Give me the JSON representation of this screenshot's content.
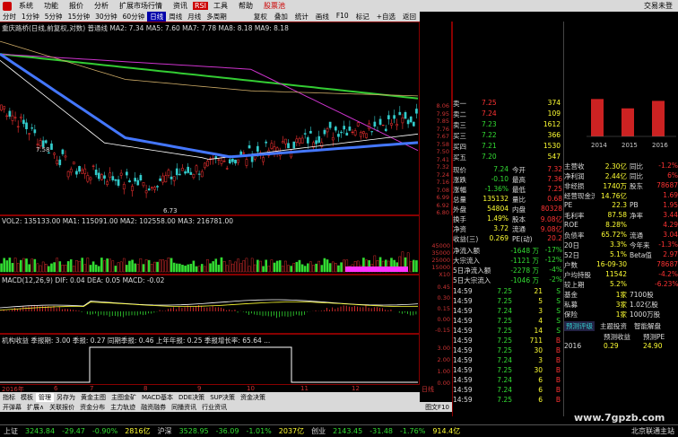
{
  "app": {
    "title_right": "交易未登",
    "menu": [
      "系统",
      "功能",
      "报价",
      "分析",
      "扩展市场行情",
      "资讯",
      "工具",
      "帮助"
    ],
    "badge": "RSI",
    "badge2": "股票池"
  },
  "periods": [
    "分时",
    "1分钟",
    "5分钟",
    "15分钟",
    "30分钟",
    "60分钟",
    "日线",
    "周线",
    "月线",
    "多周期"
  ],
  "period_active": 6,
  "toolbar": [
    "复权",
    "叠加",
    "统计",
    "画线",
    "F10",
    "标记",
    "+自选",
    "返回"
  ],
  "kline": {
    "header": "重庆路桥(日线,前复权,对数) 普通线 MA2: 7.34 MA5: 7.60 MA7: 7.78 MA8: 8.18 MA9: 8.18",
    "high_label": "7.58",
    "low_label": "6.73",
    "axis": [
      "8.06",
      "7.95",
      "7.85",
      "7.76",
      "7.67",
      "7.58",
      "7.50",
      "7.41",
      "7.32",
      "7.24",
      "7.16",
      "7.08",
      "6.99",
      "6.92",
      "6.80"
    ]
  },
  "volume": {
    "header": "VOL2: 135133.00 MA1: 115091.00 MA2: 102558.00 MA3: 216781.00",
    "axis": [
      "45000",
      "35000",
      "25000",
      "15000",
      "X10"
    ]
  },
  "macd": {
    "header": "MACD(12,26,9) DIF: 0.04 DEA: 0.05 MACD: -0.02",
    "axis": [
      "0.45",
      "0.30",
      "0.15",
      "0.00",
      "-0.15"
    ]
  },
  "ind": {
    "header": "机构收益 季报期: 3.00 季报: 0.27 同期季报: 0.46 上年年报: 0.25 季报增长率: 65.64 ...",
    "axis": [
      "3.00",
      "2.00",
      "1.00",
      "0.00"
    ]
  },
  "time_axis": [
    "2016年",
    "6",
    "7",
    "8",
    "9",
    "10",
    "11",
    "12",
    "日线"
  ],
  "tabs": [
    "指标",
    "模板",
    "管理",
    "另存为",
    "黄金主图",
    "主图金矿",
    "MACD基本",
    "DDE决策",
    "SUP决策",
    "资金决策"
  ],
  "subtabs": [
    "开弹幕",
    "扩展∧",
    "关联报价",
    "资金分布",
    "主力轨迹",
    "融资融券",
    "同播资讯",
    "行业资讯",
    "图文F10"
  ],
  "quote": {
    "asks": [
      {
        "label": "卖一",
        "price": "7.25",
        "vol": "374"
      },
      {
        "label": "卖二",
        "price": "7.24",
        "vol": "109"
      },
      {
        "label": "卖三",
        "price": "7.23",
        "vol": "1612"
      },
      {
        "label": "买三",
        "price": "7.22",
        "vol": "366"
      },
      {
        "label": "买四",
        "price": "7.21",
        "vol": "1530"
      },
      {
        "label": "买五",
        "price": "7.20",
        "vol": "547"
      }
    ],
    "stats": [
      {
        "l1": "现价",
        "v1": "7.24",
        "l2": "今开",
        "v2": "7.32"
      },
      {
        "l1": "涨跌",
        "v1": "-0.10",
        "l2": "最高",
        "v2": "7.36"
      },
      {
        "l1": "涨幅",
        "v1": "-1.36%",
        "l2": "最低",
        "v2": "7.25"
      },
      {
        "l1": "总量",
        "v1": "135132",
        "l2": "量比",
        "v2": "0.68"
      },
      {
        "l1": "外盘",
        "v1": "54804",
        "l2": "内盘",
        "v2": "80328"
      },
      {
        "l1": "换手",
        "v1": "1.49%",
        "l2": "股本",
        "v2": "9.08亿"
      },
      {
        "l1": "净资",
        "v1": "3.72",
        "l2": "流通",
        "v2": "9.08亿"
      },
      {
        "l1": "收益(三)",
        "v1": "0.269",
        "l2": "PE(动)",
        "v2": "20.2"
      }
    ],
    "flows": [
      {
        "label": "净流入额",
        "v1": "-1648 万",
        "v2": "-17%"
      },
      {
        "label": "大宗流入",
        "v1": "-1121 万",
        "v2": "-12%"
      },
      {
        "label": "5日净流入额",
        "v1": "-2278 万",
        "v2": "-4%"
      },
      {
        "label": "5日大宗流入",
        "v1": "-1046 万",
        "v2": "-2%"
      }
    ],
    "ticks": [
      {
        "t": "14:59",
        "p": "7.25",
        "v": "21",
        "s": "S"
      },
      {
        "t": "14:59",
        "p": "7.25",
        "v": "5",
        "s": "S"
      },
      {
        "t": "14:59",
        "p": "7.24",
        "v": "3",
        "s": "S"
      },
      {
        "t": "14:59",
        "p": "7.25",
        "v": "4",
        "s": "S"
      },
      {
        "t": "14:59",
        "p": "7.25",
        "v": "14",
        "s": "S"
      },
      {
        "t": "14:59",
        "p": "7.25",
        "v": "711",
        "s": "B"
      },
      {
        "t": "14:59",
        "p": "7.25",
        "v": "30",
        "s": "B"
      },
      {
        "t": "14:59",
        "p": "7.24",
        "v": "3",
        "s": "B"
      },
      {
        "t": "14:59",
        "p": "7.25",
        "v": "30",
        "s": "B"
      },
      {
        "t": "14:59",
        "p": "7.24",
        "v": "6",
        "s": "B"
      },
      {
        "t": "14:59",
        "p": "7.24",
        "v": "6",
        "s": "B"
      },
      {
        "t": "14:59",
        "p": "7.25",
        "v": "6",
        "s": "B"
      }
    ]
  },
  "info": {
    "mini_chart": {
      "type": "bar",
      "categories": [
        "2014",
        "2015",
        "2016"
      ],
      "values": [
        1.0,
        0.75,
        0.95
      ],
      "ylim": [
        0,
        1.2
      ]
    },
    "rows": [
      {
        "l": "主营收",
        "v": "2.30亿",
        "l2": "同比",
        "v2": "-1.2%"
      },
      {
        "l": "净利润",
        "v": "2.44亿",
        "l2": "同比",
        "v2": "6%"
      },
      {
        "l": "非经损",
        "v": "1740万",
        "l2": "股东",
        "v2": "78687"
      },
      {
        "l": "经营现金流",
        "v": "14.76亿",
        "l2": "",
        "v2": "1.69"
      },
      {
        "l": "PE",
        "v": "22.3",
        "l2": "PB",
        "v2": "1.95"
      },
      {
        "l": "毛利率",
        "v": "87.58",
        "l2": "净率",
        "v2": "3.44"
      },
      {
        "l": "ROE",
        "v": "8.28%",
        "l2": "",
        "v2": "4.29"
      },
      {
        "l": "负债率",
        "v": "65.72%",
        "l2": "流通",
        "v2": "3.04"
      },
      {
        "l": "20日",
        "v": "3.3%",
        "l2": "今年来",
        "v2": "-1.3%"
      },
      {
        "l": "52日",
        "v": "5.1%",
        "l2": "Beta值",
        "v2": "2.97"
      },
      {
        "l": "户数",
        "v": "16-09-30",
        "l2": "",
        "v2": "78687"
      },
      {
        "l": "户均持股",
        "v": "11542",
        "l2": "",
        "v2": "-4.2%"
      },
      {
        "l": "较上期",
        "v": "5.2%",
        "l2": "",
        "v2": "-6.23%"
      },
      {
        "l": "基金",
        "v": "1家",
        "l2": "7100股",
        "v2": ""
      },
      {
        "l": "私募",
        "v": "3家",
        "l2": "1.02亿股",
        "v2": ""
      },
      {
        "l": "保险",
        "v": "1家",
        "l2": "1000万股",
        "v2": ""
      }
    ],
    "rating_tabs": [
      "预测评级",
      "主题投资",
      "智能解盘"
    ],
    "forecast_header": [
      "预测收益",
      "预测PE"
    ],
    "forecast_row": [
      "2016",
      "0.29",
      "24.90"
    ]
  },
  "status": {
    "items": [
      {
        "label": "上证",
        "value": "3243.84",
        "change": "-29.47",
        "pct": "-0.90%",
        "amount": "2816亿"
      },
      {
        "label": "沪深",
        "value": "3528.95",
        "change": "-36.09",
        "pct": "-1.01%",
        "amount": "2037亿"
      },
      {
        "label": "创业",
        "value": "2143.45",
        "change": "-31.48",
        "pct": "-1.76%",
        "amount": "914.4亿"
      }
    ],
    "right": "北京联通主站",
    "watermark": "www.7gpzb.com"
  },
  "colors": {
    "bg": "#000000",
    "up": "#ff3333",
    "down": "#33dd33",
    "ma_green": "#33cc33",
    "ma_blue": "#4477ff",
    "ma_magenta": "#cc33cc",
    "ma_khaki": "#ccaa66"
  }
}
